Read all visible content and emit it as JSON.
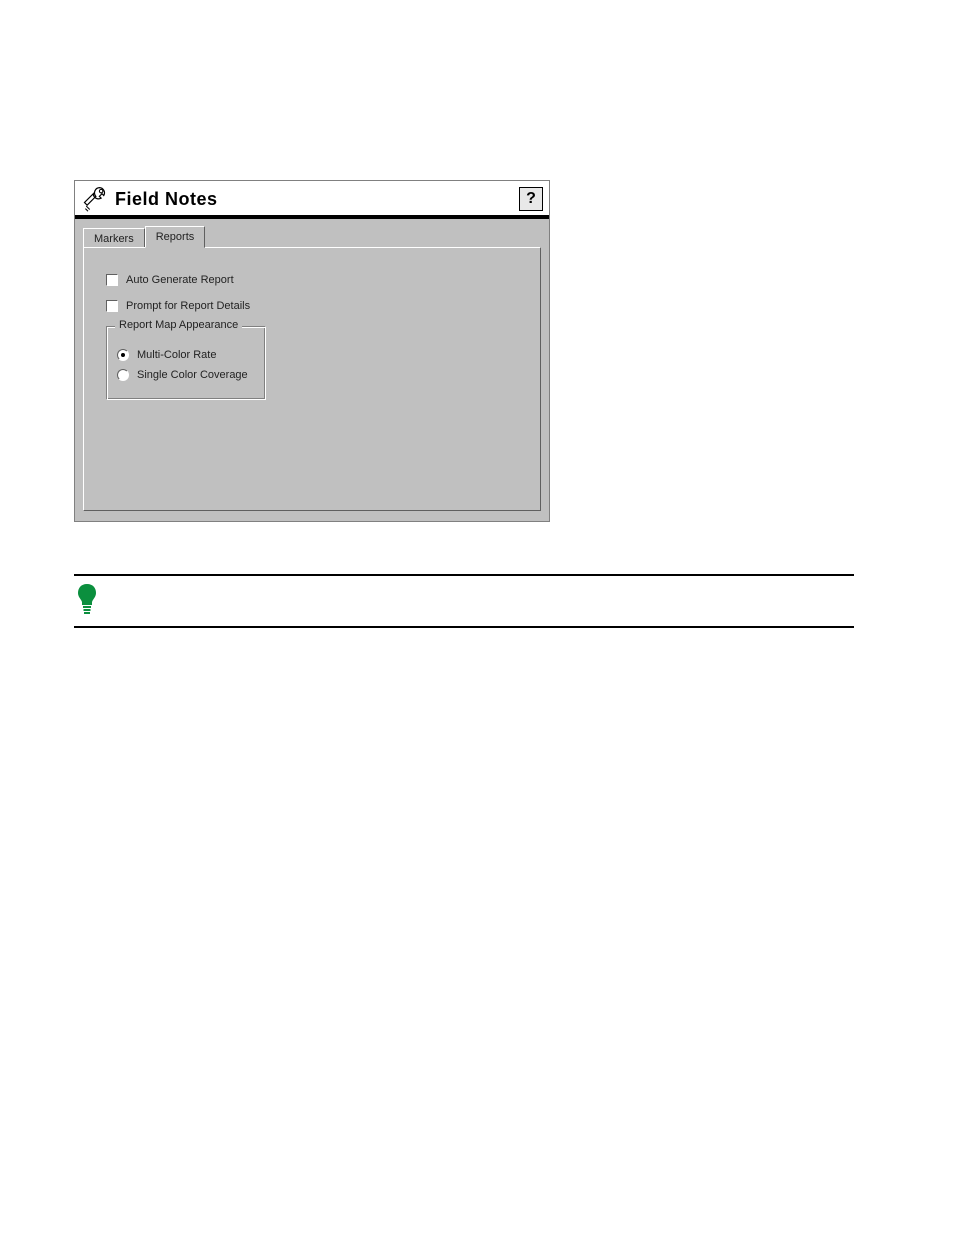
{
  "dialog": {
    "title": "Field Notes",
    "help_label": "?",
    "tabs": {
      "markers": "Markers",
      "reports": "Reports"
    },
    "checks": {
      "auto_generate": "Auto Generate Report",
      "prompt_details": "Prompt for Report Details"
    },
    "group": {
      "legend": "Report Map Appearance",
      "multi_color": "Multi-Color Rate",
      "single_color": "Single Color Coverage"
    }
  },
  "icons": {
    "wrench": "wrench-icon",
    "bulb": "tip-bulb-icon"
  }
}
